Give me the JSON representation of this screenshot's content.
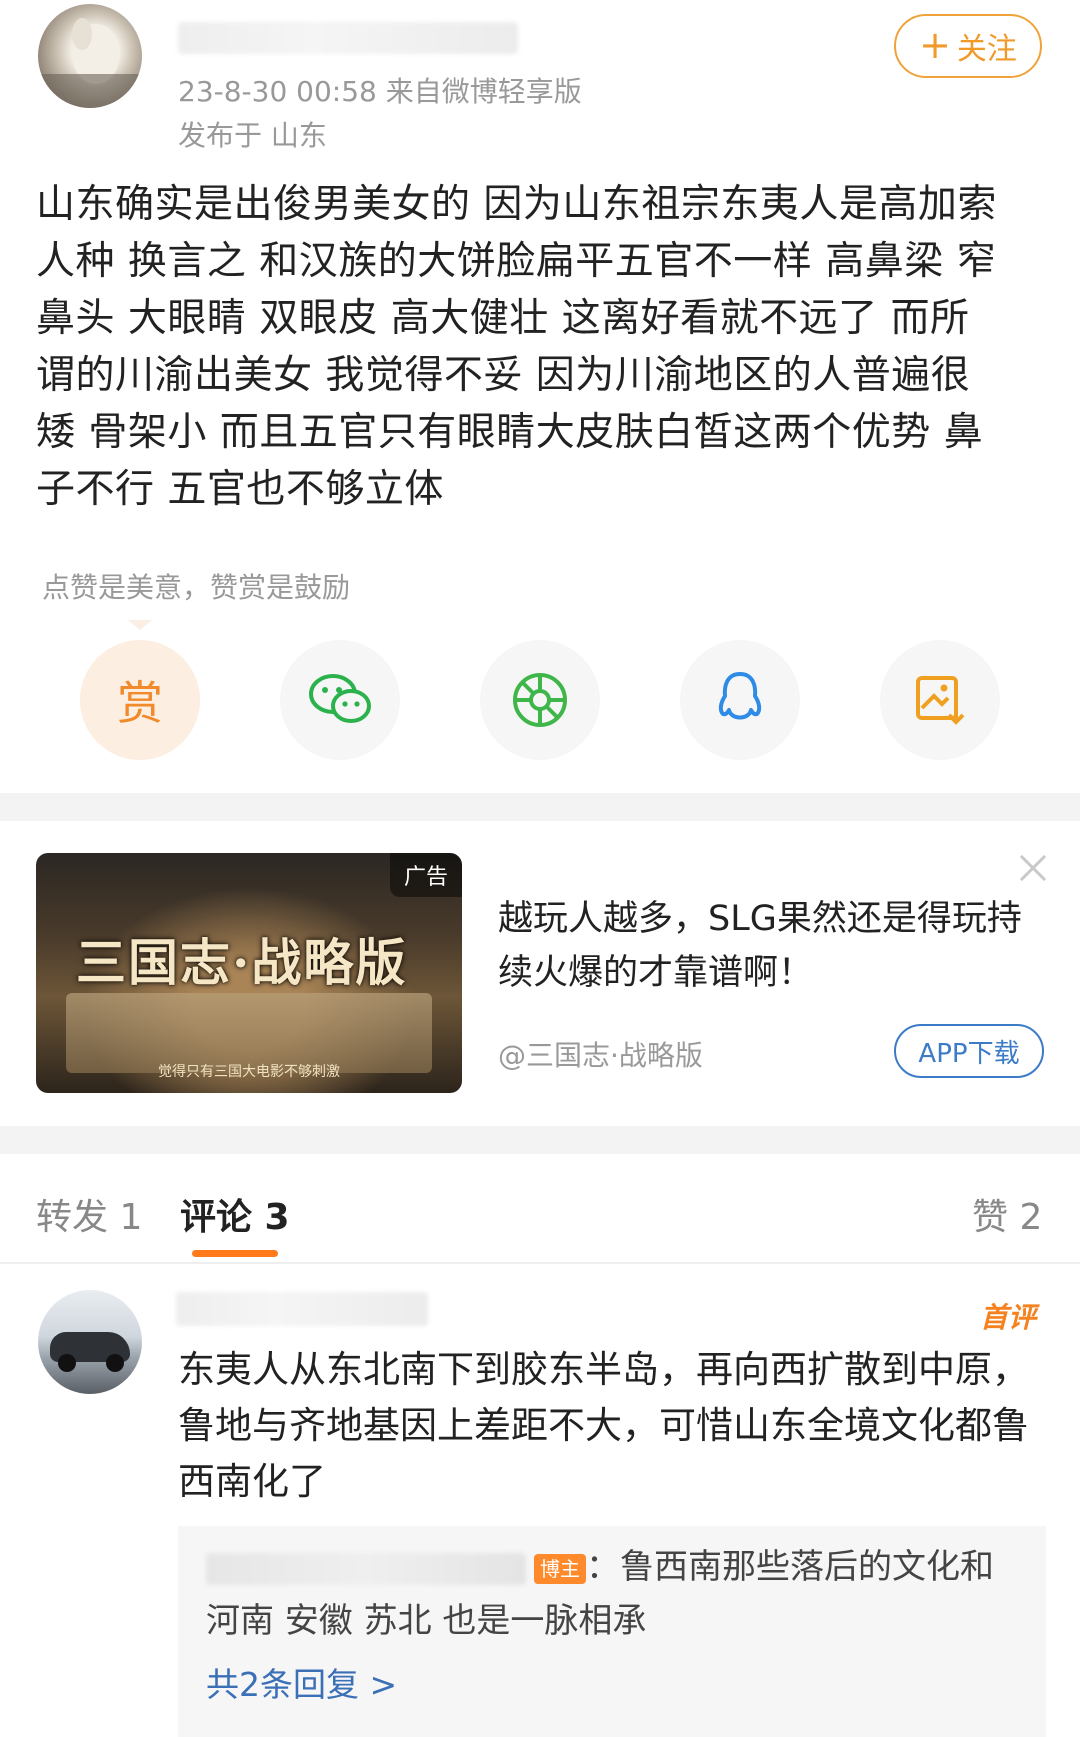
{
  "post": {
    "meta_line": "23-8-30 00:58  来自微博轻享版",
    "location": "发布于 山东",
    "follow_label": "关注",
    "body": "山东确实是出俊男美女的 因为山东祖宗东夷人是高加索\n人种 换言之 和汉族的大饼脸扁平五官不一样 高鼻梁 窄\n鼻头 大眼睛 双眼皮 高大健壮 这离好看就不远了   而所\n谓的川渝出美女 我觉得不妥 因为川渝地区的人普遍很\n矮 骨架小 而且五官只有眼睛大皮肤白皙这两个优势 鼻\n子不行 五官也不够立体",
    "like_hint": "点赞是美意，赞赏是鼓励",
    "reward_label": "赏",
    "share_icons": [
      "reward-icon",
      "wechat-icon",
      "moments-icon",
      "qq-icon",
      "save-image-icon"
    ]
  },
  "ad": {
    "tag": "广告",
    "image_logo": "三国志·战略版",
    "image_subtitle": "觉得只有三国大电影不够刺激",
    "title": "越玩人越多，SLG果然还是得玩持续火爆的才靠谱啊！",
    "source": "@三国志·战略版",
    "download_label": "APP下载"
  },
  "tabs": {
    "repost": "转发 1",
    "comments": "评论 3",
    "likes": "赞 2"
  },
  "comment": {
    "badge": "首评",
    "text": "东夷人从东北南下到胶东半岛，再向西扩散到中原，鲁地与齐地基因上差距不大，可惜山东全境文化都鲁西南化了",
    "reply_badge": "博主",
    "reply_text": "：鲁西南那些落后的文化和河南 安徽 苏北 也是一脉相承",
    "more_replies": "共2条回复 >"
  },
  "colors": {
    "accent_orange": "#f09a2a",
    "link_blue": "#3b6fb6",
    "tab_underline": "#ff7a1a"
  }
}
